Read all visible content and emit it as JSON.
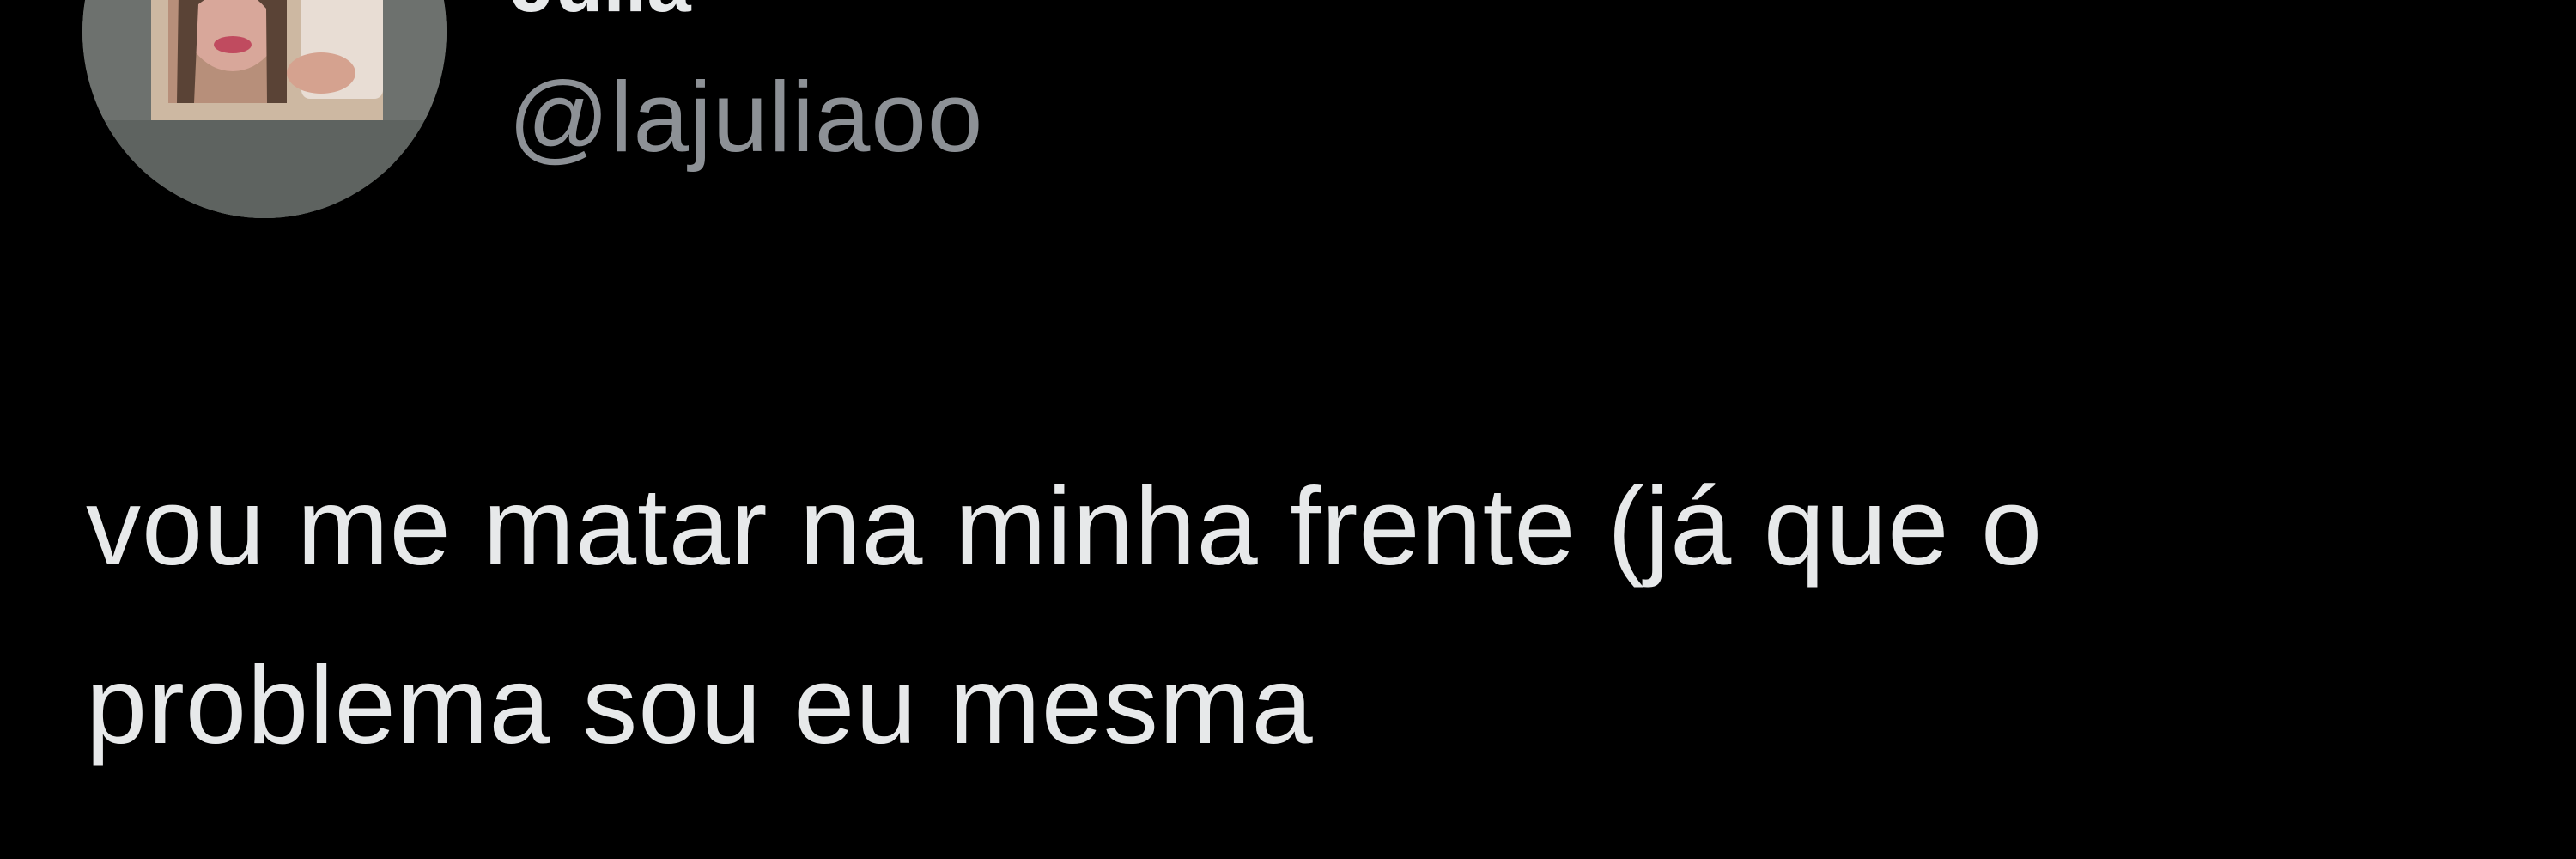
{
  "tweet": {
    "author": {
      "display_name": "Julia",
      "handle": "@lajuliaoo"
    },
    "text_lines": [
      "vou me matar na minha frente (já que o",
      "problema sou eu mesma"
    ]
  },
  "colors": {
    "background": "#000000",
    "text_primary": "#e7e9ea",
    "text_secondary": "#8d9196"
  },
  "icons": {
    "avatar": "profile-photo"
  }
}
